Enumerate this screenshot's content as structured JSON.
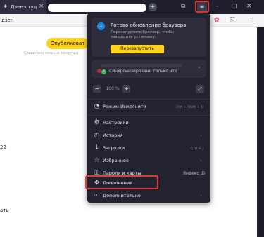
{
  "tab": {
    "title": "Дзен-студ"
  },
  "toolbar": {
    "left_text": "дзен"
  },
  "page": {
    "publish_label": "Опубликоват",
    "saved_text": "Сохранено меньше минуты н",
    "fragment_year": "22",
    "fragment_word": "ать"
  },
  "menu": {
    "update": {
      "title": "Готово обновление браузера",
      "description": "Перезапустите браузер, чтобы завершить установку.",
      "button": "Перезапустить"
    },
    "sync": {
      "text": "Синхронизировано только что"
    },
    "zoom": {
      "value": "100 %"
    },
    "items": [
      {
        "label": "Режим Инкогнито",
        "shortcut": "Ctrl + Shift + N"
      },
      {
        "label": "Настройки"
      },
      {
        "label": "История"
      },
      {
        "label": "Загрузки",
        "shortcut": "Ctrl + J"
      },
      {
        "label": "Избранное"
      },
      {
        "label": "Пароли и карты",
        "badge": "Яндекс ID"
      },
      {
        "label": "Дополнения"
      },
      {
        "label": "Дополнительно"
      }
    ]
  },
  "colors": {
    "menu_bg": "#23232f",
    "accent_yellow": "#ffd21f",
    "highlight_red": "#e53935"
  }
}
